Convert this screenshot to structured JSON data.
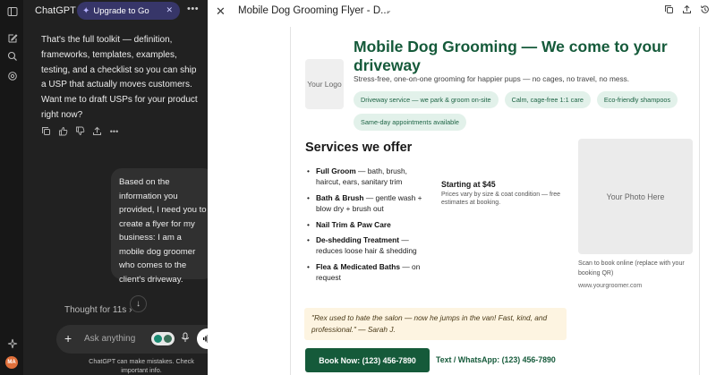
{
  "sidebar": {
    "user_initials": "MA"
  },
  "header": {
    "brand": "ChatGPT",
    "upgrade_label": "Upgrade to Go"
  },
  "conversation": {
    "assistant_text": "That's the full toolkit — definition, frameworks, templates, examples, testing, and a checklist so you can ship a USP that actually moves customers. Want me to draft USPs for your product right now?",
    "user_message": "Based on the information you provided, I need you to create a flyer for my business: I am a mobile dog groomer who comes to the client's driveway.",
    "thought_label": "Thought for 11s"
  },
  "composer": {
    "placeholder": "Ask anything",
    "disclaimer": "ChatGPT can make mistakes. Check important info."
  },
  "canvas": {
    "title": "Mobile Dog Grooming Flyer - D...",
    "flyer": {
      "logo_placeholder": "Your Logo",
      "headline": "Mobile Dog Grooming — We come to your driveway",
      "subline": "Stress-free, one-on-one grooming for happier pups — no cages, no travel, no mess.",
      "chips": [
        "Driveway service — we park & groom on-site",
        "Calm, cage-free 1:1 care",
        "Eco-friendly shampoos",
        "Same-day appointments available"
      ],
      "services_title": "Services we offer",
      "services": [
        {
          "name": "Full Groom",
          "desc": "— bath, brush, haircut, ears, sanitary trim"
        },
        {
          "name": "Bath & Brush",
          "desc": "— gentle wash + blow dry + brush out"
        },
        {
          "name": "Nail Trim & Paw Care",
          "desc": ""
        },
        {
          "name": "De-shedding Treatment",
          "desc": "— reduces loose hair & shedding"
        },
        {
          "name": "Flea & Medicated Baths",
          "desc": "— on request"
        }
      ],
      "price_title": "Starting at $45",
      "price_note": "Prices vary by size & coat condition — free estimates at booking.",
      "photo_placeholder": "Your Photo Here",
      "scan_note": "Scan to book online (replace with your booking QR)",
      "website": "www.yourgroomer.com",
      "testimonial": "\"Rex used to hate the salon — now he jumps in the van! Fast, kind, and professional.\" — Sarah J.",
      "book_cta": "Book Now: (123) 456-7890",
      "text_cta": "Text / WhatsApp: (123) 456-7890"
    }
  },
  "colors": {
    "brand_green": "#155a3a",
    "chip_bg": "#e2f1ea",
    "upgrade_bg": "#373669",
    "quote_bg": "#fdf4e1"
  }
}
